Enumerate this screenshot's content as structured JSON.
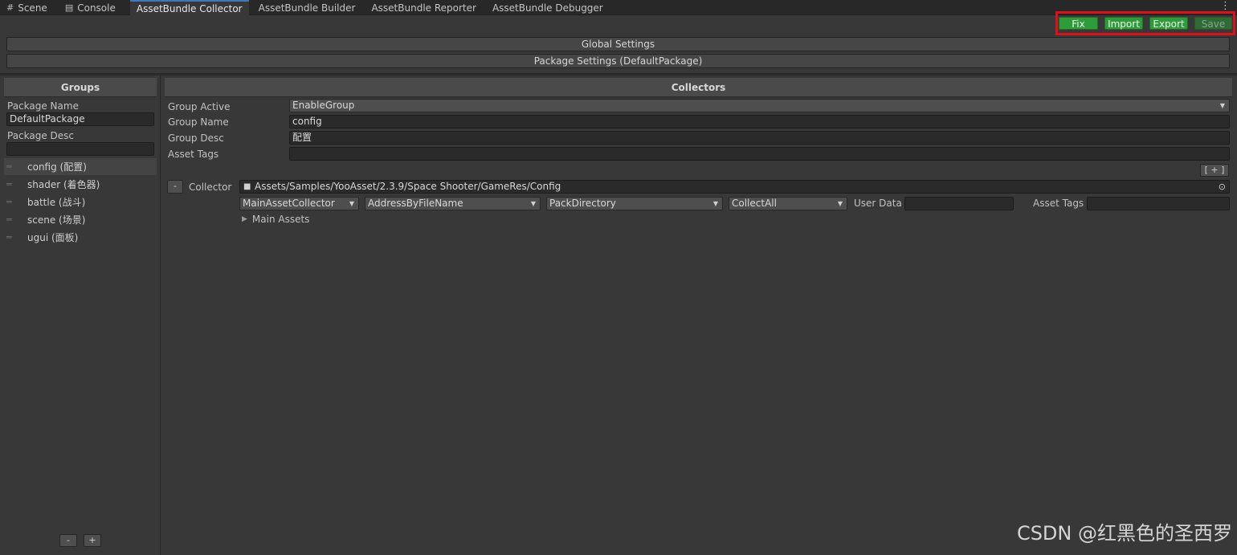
{
  "tabs": [
    {
      "label": "Scene",
      "icon": "grid-icon"
    },
    {
      "label": "Console",
      "icon": "console-icon"
    },
    {
      "label": "AssetBundle Collector",
      "active": true
    },
    {
      "label": "AssetBundle Builder"
    },
    {
      "label": "AssetBundle Reporter"
    },
    {
      "label": "AssetBundle Debugger"
    }
  ],
  "toolbar": {
    "fix": "Fix",
    "import": "Import",
    "export": "Export",
    "save": "Save",
    "highlight_color": "#e0101a"
  },
  "sections": {
    "global_settings": "Global Settings",
    "package_settings": "Package Settings (DefaultPackage)"
  },
  "groups_panel": {
    "header": "Groups",
    "package_name_label": "Package Name",
    "package_name_value": "DefaultPackage",
    "package_desc_label": "Package Desc",
    "package_desc_value": "",
    "items": [
      {
        "label": "config (配置)",
        "selected": true
      },
      {
        "label": "shader (着色器)"
      },
      {
        "label": "battle (战斗)"
      },
      {
        "label": "scene (场景)"
      },
      {
        "label": "ugui (面板)"
      }
    ],
    "remove_label": "-",
    "add_label": "+"
  },
  "collectors_panel": {
    "header": "Collectors",
    "group_active_label": "Group Active",
    "group_active_value": "EnableGroup",
    "group_name_label": "Group Name",
    "group_name_value": "config",
    "group_desc_label": "Group Desc",
    "group_desc_value": "配置",
    "asset_tags_label": "Asset Tags",
    "asset_tags_value": "",
    "add_collector_label": "[ + ]",
    "collector": {
      "remove_label": "-",
      "label": "Collector",
      "path": "Assets/Samples/YooAsset/2.3.9/Space Shooter/GameRes/Config",
      "collector_type": "MainAssetCollector",
      "address_rule": "AddressByFileName",
      "pack_rule": "PackDirectory",
      "filter_rule": "CollectAll",
      "user_data_label": "User Data",
      "user_data_value": "",
      "asset_tags_label": "Asset Tags",
      "asset_tags_value": "",
      "main_assets_label": "Main Assets"
    }
  },
  "watermark": "CSDN @红黑色的圣西罗"
}
